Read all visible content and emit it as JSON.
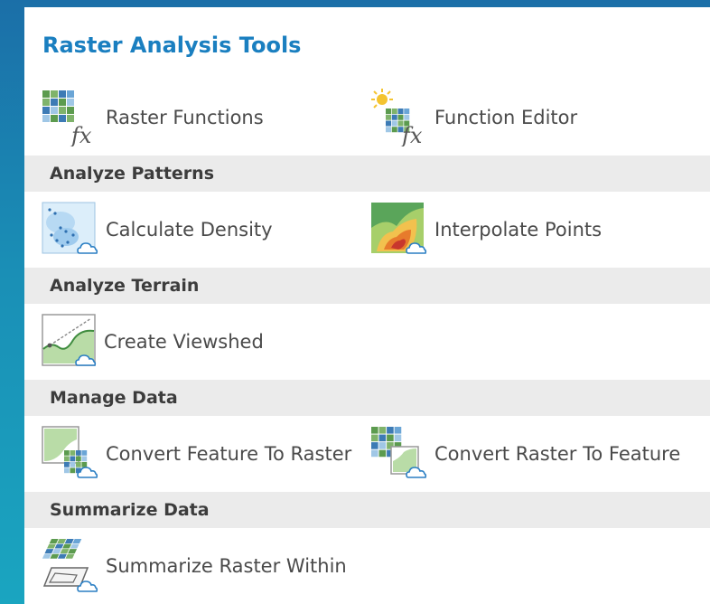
{
  "panel": {
    "title": "Raster Analysis Tools",
    "top_tools": [
      {
        "label": "Raster Functions",
        "icon": "raster-functions-icon"
      },
      {
        "label": "Function Editor",
        "icon": "function-editor-icon"
      }
    ],
    "sections": [
      {
        "heading": "Analyze Patterns",
        "tools": [
          {
            "label": "Calculate Density",
            "icon": "calculate-density-icon"
          },
          {
            "label": "Interpolate Points",
            "icon": "interpolate-points-icon"
          }
        ]
      },
      {
        "heading": "Analyze Terrain",
        "tools": [
          {
            "label": "Create Viewshed",
            "icon": "create-viewshed-icon"
          }
        ]
      },
      {
        "heading": "Manage Data",
        "tools": [
          {
            "label": "Convert Feature To Raster",
            "icon": "convert-feature-to-raster-icon"
          },
          {
            "label": "Convert Raster To Feature",
            "icon": "convert-raster-to-feature-icon"
          }
        ]
      },
      {
        "heading": "Summarize Data",
        "tools": [
          {
            "label": "Summarize Raster Within",
            "icon": "summarize-raster-within-icon"
          }
        ]
      }
    ]
  },
  "colors": {
    "title": "#1a7fc0",
    "section_bg": "#ebebeb",
    "cloud_outline": "#2b7fc4"
  }
}
